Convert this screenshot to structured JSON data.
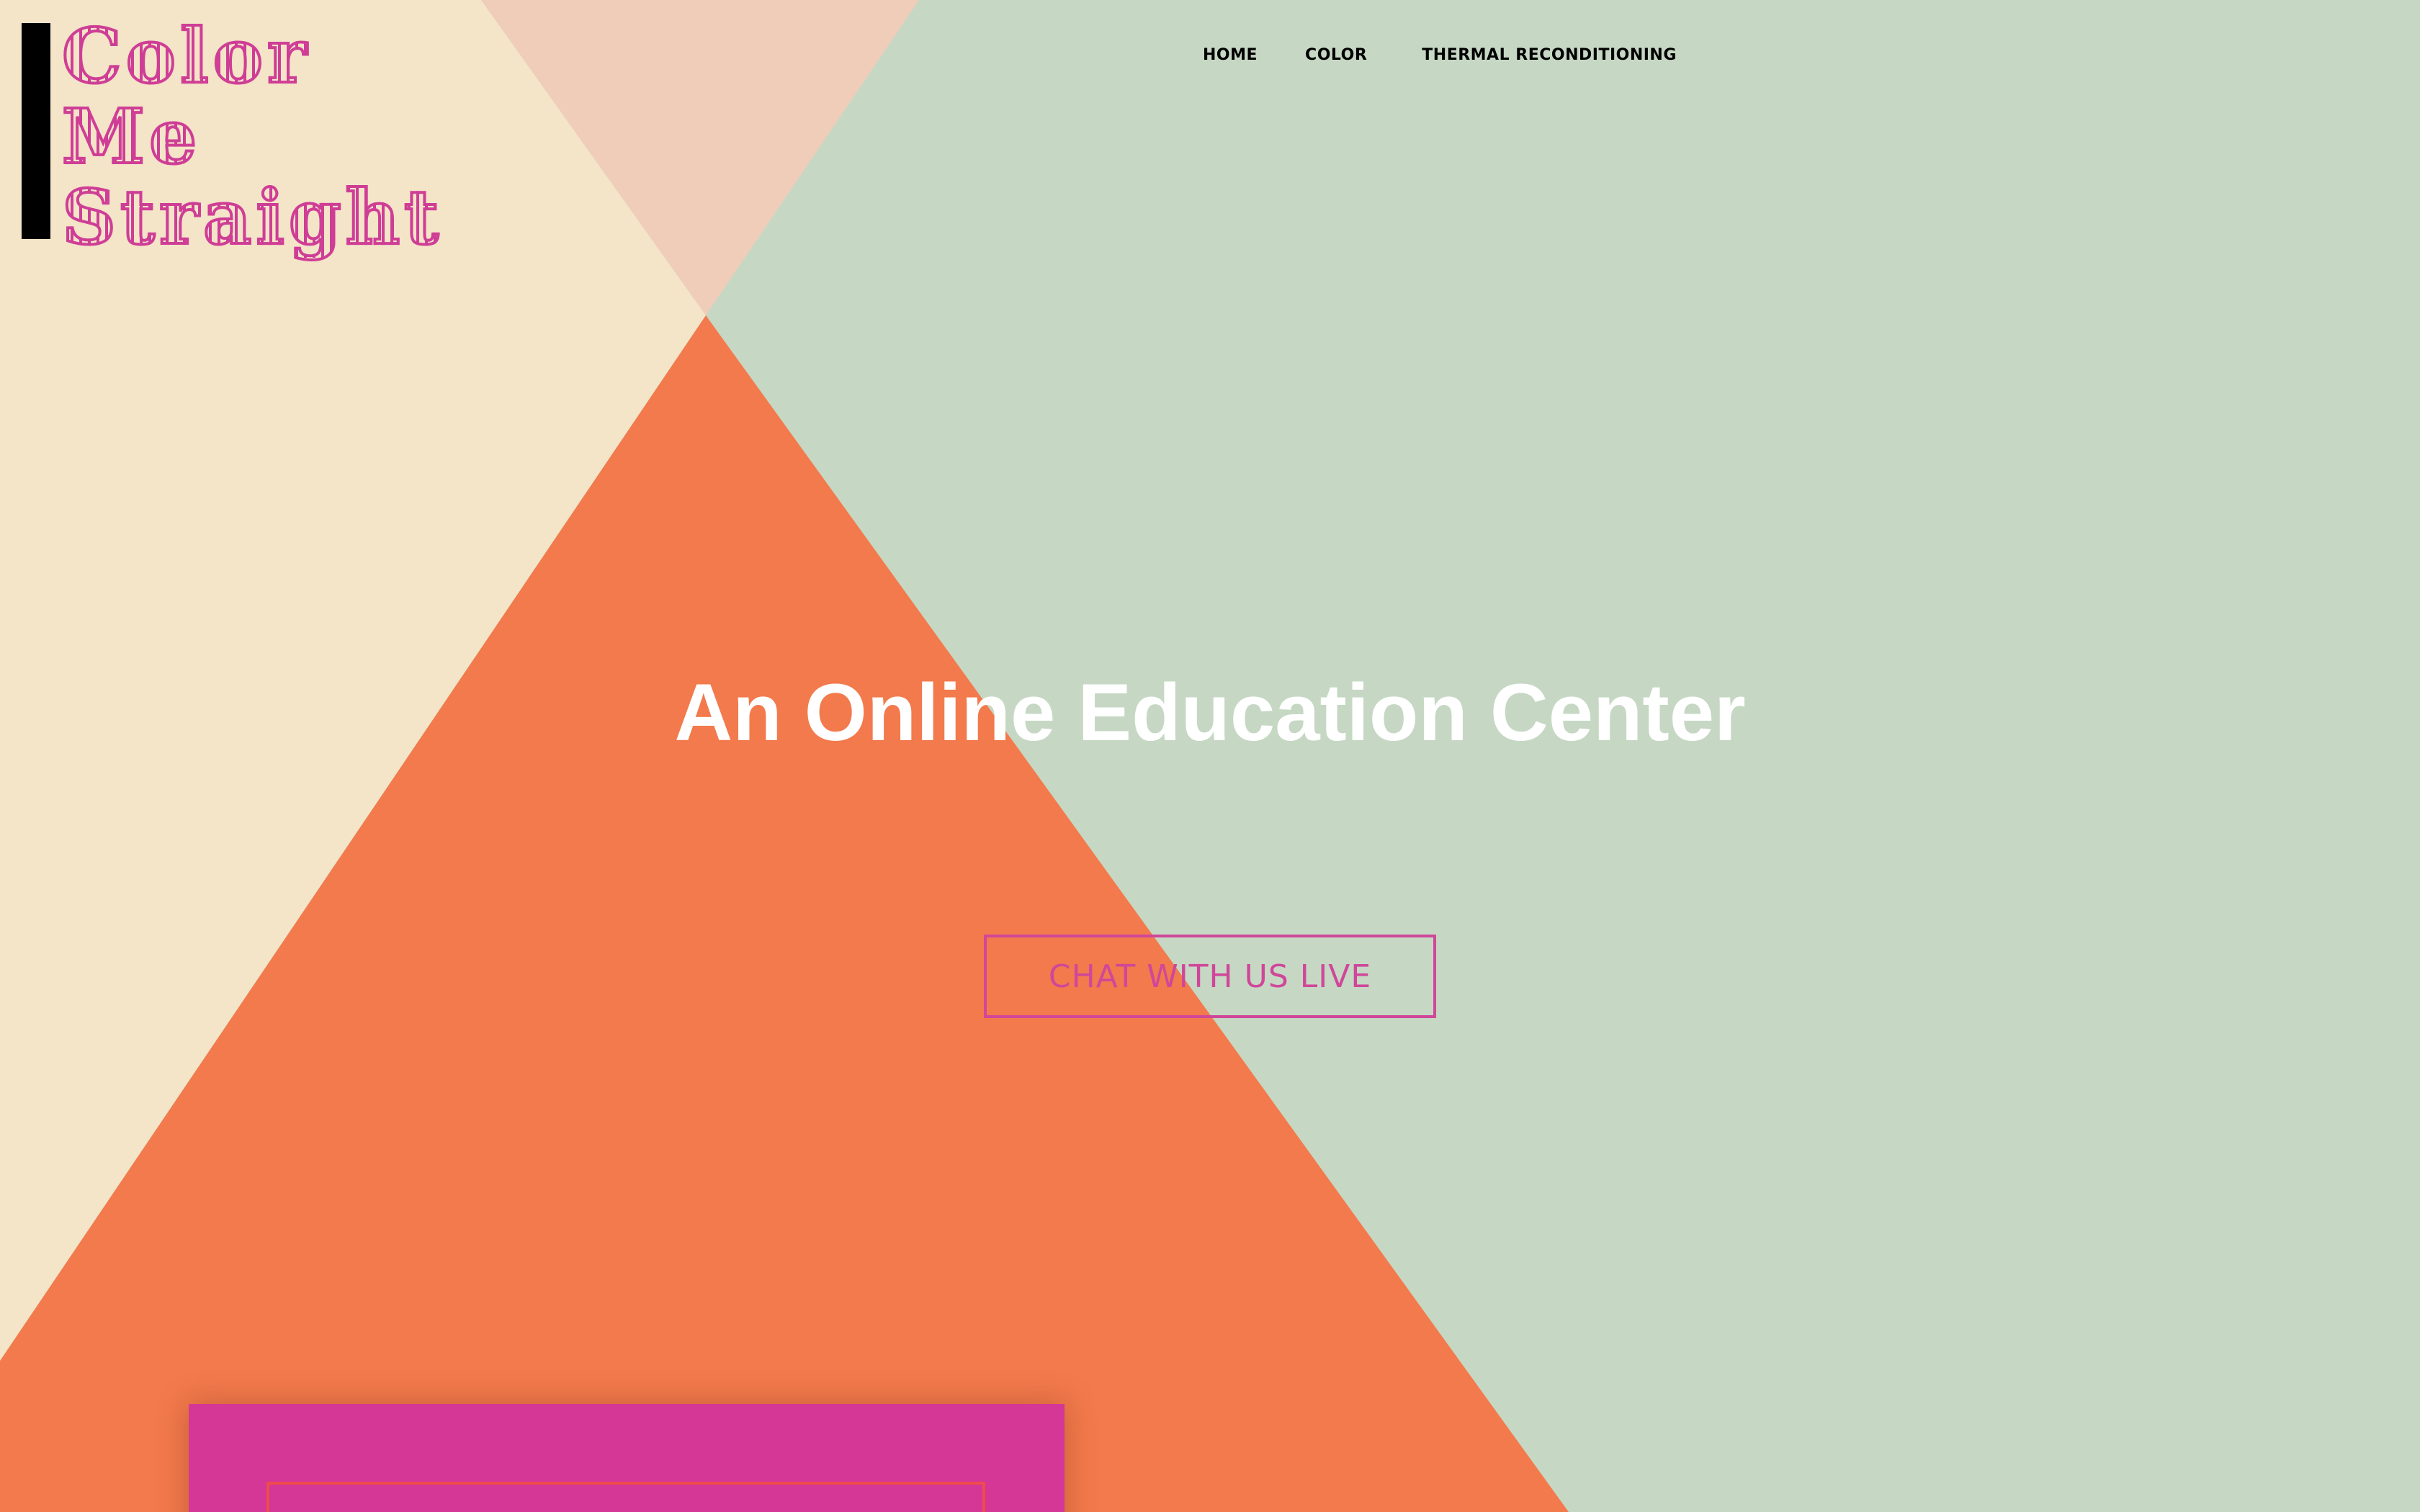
{
  "site": {
    "logo": {
      "line1": "Color",
      "line2": "Me",
      "line3": "Straight"
    }
  },
  "nav": {
    "items": [
      {
        "label": "HOME"
      },
      {
        "label": "COLOR"
      },
      {
        "label": "THERMAL RECONDITIONING"
      }
    ]
  },
  "hero": {
    "title": "An Online Education Center",
    "cta_label": "CHAT WITH US LIVE"
  },
  "colors": {
    "background_green": "#c6d8c4",
    "cream": "#f4e4c8",
    "peach": "#efcdb9",
    "orange": "#f27a4c",
    "accent_magenta": "#d0479a",
    "card_magenta": "#d43795",
    "card_border_red": "#ef4c4c"
  }
}
